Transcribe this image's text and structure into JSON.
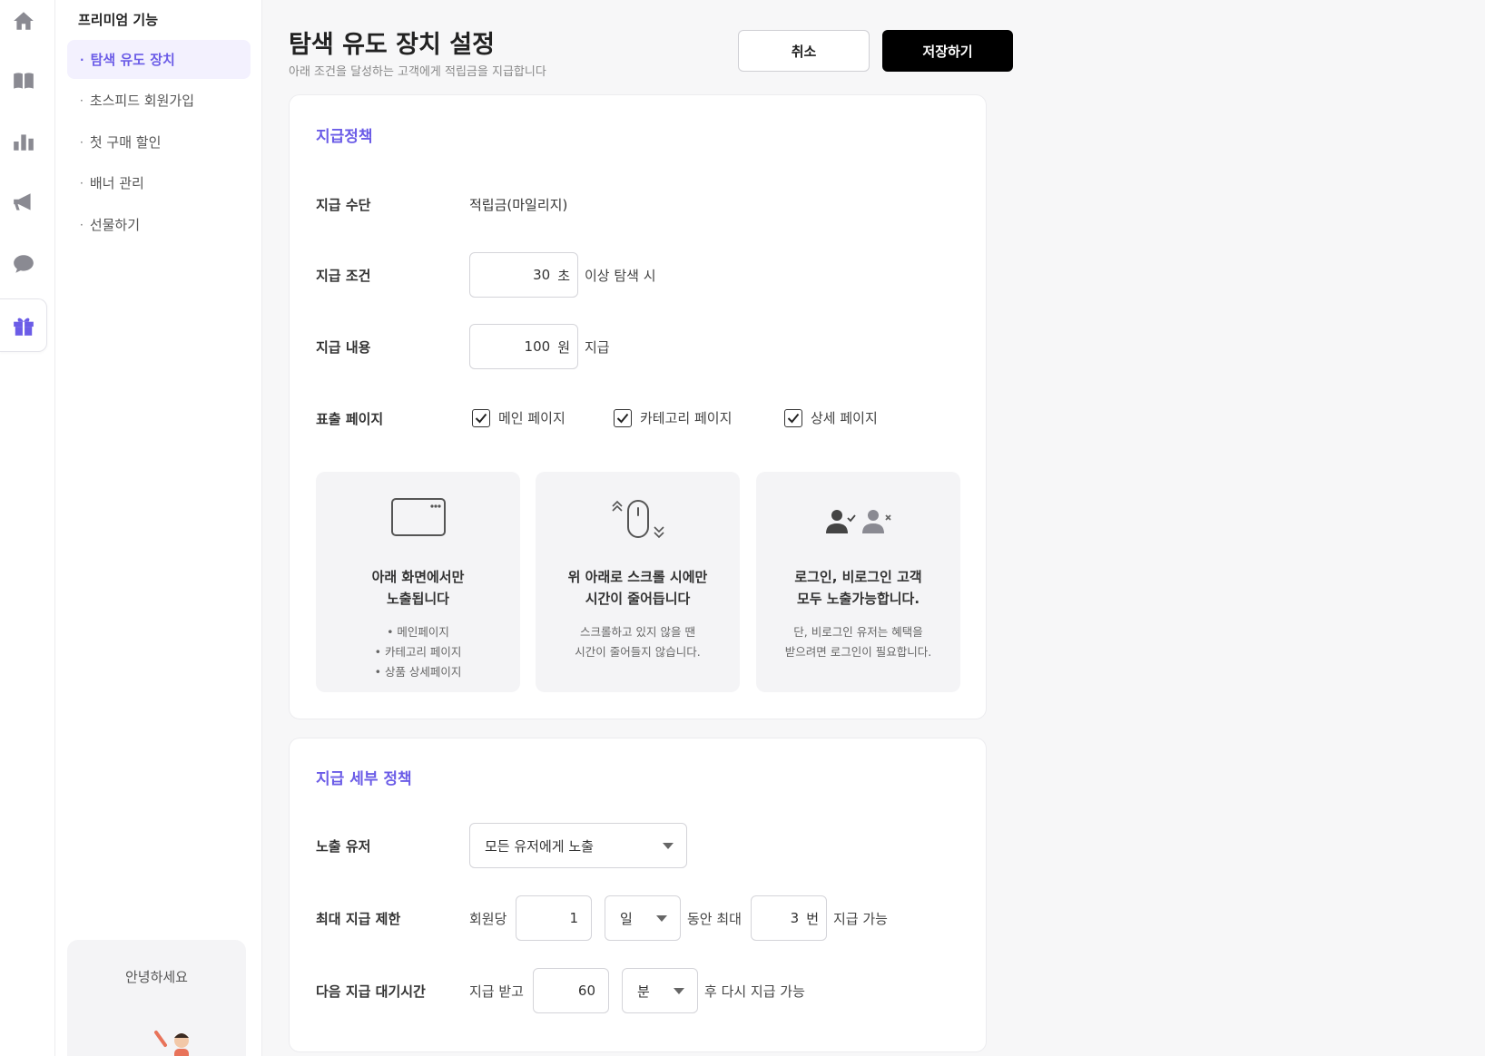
{
  "rail": {
    "items": [
      {
        "icon": "home-icon"
      },
      {
        "icon": "book-icon"
      },
      {
        "icon": "bar-chart-icon"
      },
      {
        "icon": "megaphone-icon"
      },
      {
        "icon": "chat-bubble-icon"
      },
      {
        "icon": "gift-icon",
        "active": true
      }
    ]
  },
  "subnav": {
    "title": "프리미엄 기능",
    "items": [
      {
        "label": "탐색 유도 장치",
        "active": true
      },
      {
        "label": "초스피드 회원가입"
      },
      {
        "label": "첫 구매 할인"
      },
      {
        "label": "배너 관리"
      },
      {
        "label": "선물하기"
      }
    ],
    "bullet": "·",
    "hello": "안녕하세요"
  },
  "header": {
    "title": "탐색 유도 장치 설정",
    "subtitle": "아래 조건을 달성하는 고객에게 적립금을 지급합니다",
    "cancel_label": "취소",
    "save_label": "저장하기"
  },
  "policy": {
    "title": "지급정책",
    "method": {
      "label": "지급 수단",
      "value": "적립금(마일리지)"
    },
    "condition": {
      "label": "지급 조건",
      "value": "30",
      "unit": "초",
      "suffix": "이상 탐색 시"
    },
    "content": {
      "label": "지급 내용",
      "value": "100",
      "unit": "원",
      "suffix": "지급"
    },
    "pages": {
      "label": "표출 페이지",
      "options": [
        {
          "label": "메인 페이지",
          "checked": true
        },
        {
          "label": "카테고리 페이지",
          "checked": true
        },
        {
          "label": "상세 페이지",
          "checked": true
        }
      ]
    },
    "info_cards": [
      {
        "icon": "browser-window-icon",
        "title_1": "아래 화면에서만",
        "title_2": "노출됩니다",
        "bullets": [
          "메인페이지",
          "카테고리 페이지",
          "상품 상세페이지"
        ]
      },
      {
        "icon": "mouse-scroll-icon",
        "title_1": "위 아래로 스크롤 시에만",
        "title_2": "시간이 줄어듭니다",
        "desc_1": "스크롤하고 있지 않을 땐",
        "desc_2": "시간이 줄어들지 않습니다."
      },
      {
        "icon": "users-login-icon",
        "title_1": "로그인, 비로그인 고객",
        "title_2": "모두 노출가능합니다.",
        "desc_1": "단, 비로그인 유저는 혜택을",
        "desc_2": "받으려면 로그인이 필요합니다."
      }
    ]
  },
  "detail": {
    "title": "지급 세부 정책",
    "exposure": {
      "label": "노출 유저",
      "selected": "모든 유저에게 노출"
    },
    "limit": {
      "label": "최대 지급 제한",
      "prefix": "회원당",
      "period_value": "1",
      "period_unit": "일",
      "middle": "동안 최대",
      "count_value": "3",
      "count_unit": "번",
      "suffix": "지급 가능"
    },
    "wait": {
      "label": "다음 지급 대기시간",
      "prefix": "지급 받고",
      "value": "60",
      "unit": "분",
      "suffix": "후 다시 지급 가능"
    }
  },
  "colors": {
    "accent": "#6b5ce7",
    "primary_button": "#000000",
    "icon_gray": "#8a8a92"
  }
}
